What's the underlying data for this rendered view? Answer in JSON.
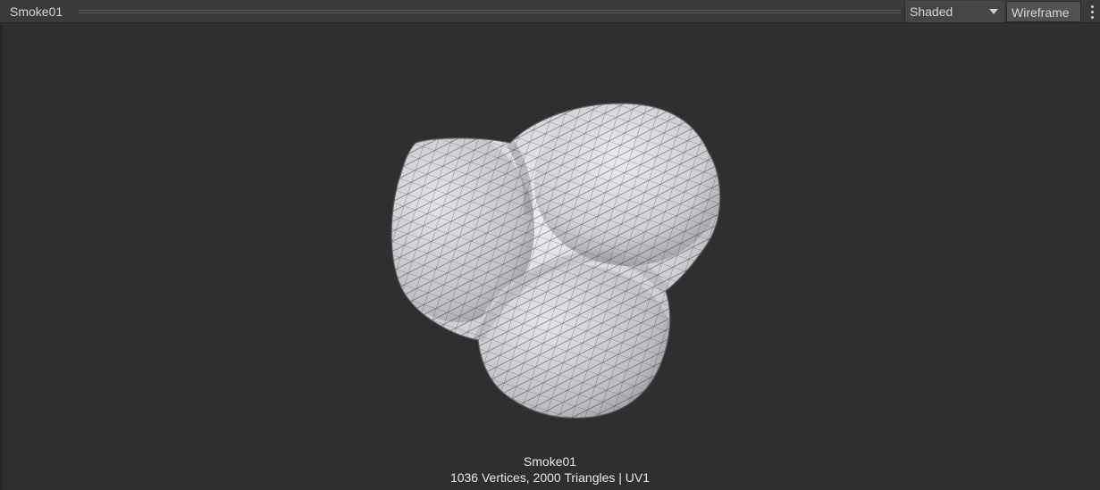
{
  "header": {
    "title": "Smoke01",
    "shading_mode": "Shaded",
    "wireframe_label": "Wireframe"
  },
  "icons": {
    "dropdown": "chevron-down-icon",
    "menu": "more-vertical-icon"
  },
  "preview": {
    "mesh_name": "Smoke01",
    "mesh_stats": "1036 Vertices, 2000 Triangles | UV1"
  },
  "colors": {
    "background": "#2f2f2f",
    "header": "#3a3a3a",
    "mesh": "#d8d8dc"
  }
}
